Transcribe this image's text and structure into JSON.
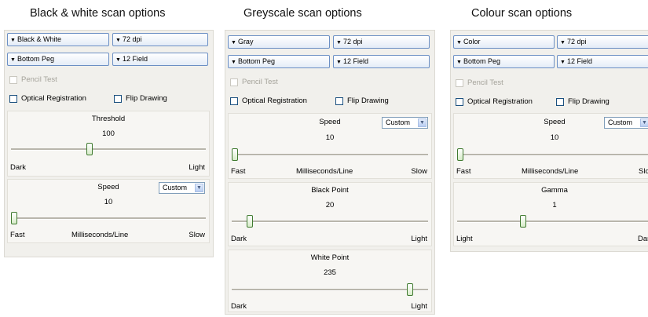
{
  "captions": {
    "bw": "Black & white scan options",
    "grey": "Greyscale scan options",
    "colour": "Colour scan options"
  },
  "bw": {
    "mode": "Black & White",
    "dpi": "72 dpi",
    "peg": "Bottom Peg",
    "field": "12 Field",
    "pencil_test": "Pencil Test",
    "optical_registration": "Optical Registration",
    "flip_drawing": "Flip Drawing",
    "threshold": {
      "title": "Threshold",
      "value": "100",
      "left": "Dark",
      "right": "Light",
      "position": 0.4
    },
    "speed": {
      "title": "Speed",
      "preset": "Custom",
      "value": "10",
      "left": "Fast",
      "center": "Milliseconds/Line",
      "right": "Slow",
      "position": 0.0
    }
  },
  "grey": {
    "mode": "Gray",
    "dpi": "72 dpi",
    "peg": "Bottom Peg",
    "field": "12 Field",
    "pencil_test": "Pencil Test",
    "optical_registration": "Optical Registration",
    "flip_drawing": "Flip Drawing",
    "speed": {
      "title": "Speed",
      "preset": "Custom",
      "value": "10",
      "left": "Fast",
      "center": "Milliseconds/Line",
      "right": "Slow",
      "position": 0.0
    },
    "black_point": {
      "title": "Black Point",
      "value": "20",
      "left": "Dark",
      "right": "Light",
      "position": 0.08
    },
    "white_point": {
      "title": "White Point",
      "value": "235",
      "left": "Dark",
      "right": "Light",
      "position": 0.92
    }
  },
  "colour": {
    "mode": "Color",
    "dpi": "72 dpi",
    "peg": "Bottom Peg",
    "field": "12 Field",
    "pencil_test": "Pencil Test",
    "optical_registration": "Optical Registration",
    "flip_drawing": "Flip Drawing",
    "speed": {
      "title": "Speed",
      "preset": "Custom",
      "value": "10",
      "left": "Fast",
      "center": "Milliseconds/Line",
      "right": "Slow",
      "position": 0.0
    },
    "gamma": {
      "title": "Gamma",
      "value": "1",
      "left": "Light",
      "right": "Dark",
      "position": 0.33
    }
  }
}
